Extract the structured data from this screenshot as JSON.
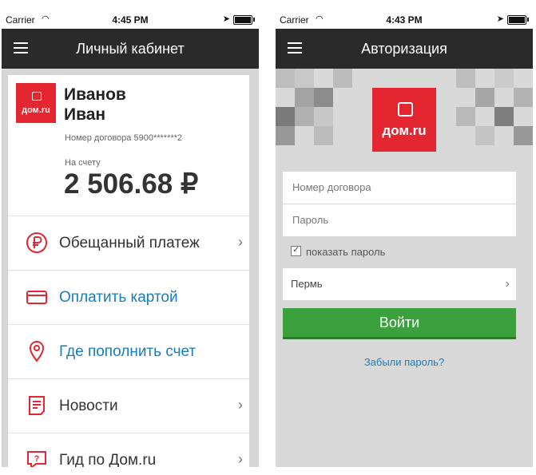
{
  "colors": {
    "brand_red": "#e3262f",
    "navbar": "#2a2a2a",
    "accent_blue": "#1a7db5",
    "button_green": "#3aa13d"
  },
  "left_screen": {
    "status": {
      "carrier": "Carrier",
      "time": "4:45 PM"
    },
    "title": "Личный кабинет",
    "logo_text": "дом.ru",
    "user": {
      "last_name": "Иванов",
      "first_name": "Иван"
    },
    "contract": "Номер договора 5900*******2",
    "balance_label": "На счету",
    "balance": "2 506.68 ₽",
    "menu": [
      {
        "label": "Обещанный платеж",
        "icon": "ruble-circle-icon",
        "chevron": "›"
      },
      {
        "label": "Оплатить картой",
        "icon": "card-icon",
        "chevron": ""
      },
      {
        "label": "Где пополнить счет",
        "icon": "location-pin-icon",
        "chevron": ""
      },
      {
        "label": "Новости",
        "icon": "news-icon",
        "chevron": "›"
      },
      {
        "label": "Гид по Дом.ru",
        "icon": "help-bubble-icon",
        "chevron": "›"
      }
    ]
  },
  "right_screen": {
    "status": {
      "carrier": "Carrier",
      "time": "4:43 PM"
    },
    "title": "Авторизация",
    "logo_text": "дом.ru",
    "contract_placeholder": "Номер договора",
    "password_placeholder": "Пароль",
    "show_password": "показать пароль",
    "city": "Пермь",
    "login_button": "Войти",
    "forgot": "Забыли пароль?"
  }
}
